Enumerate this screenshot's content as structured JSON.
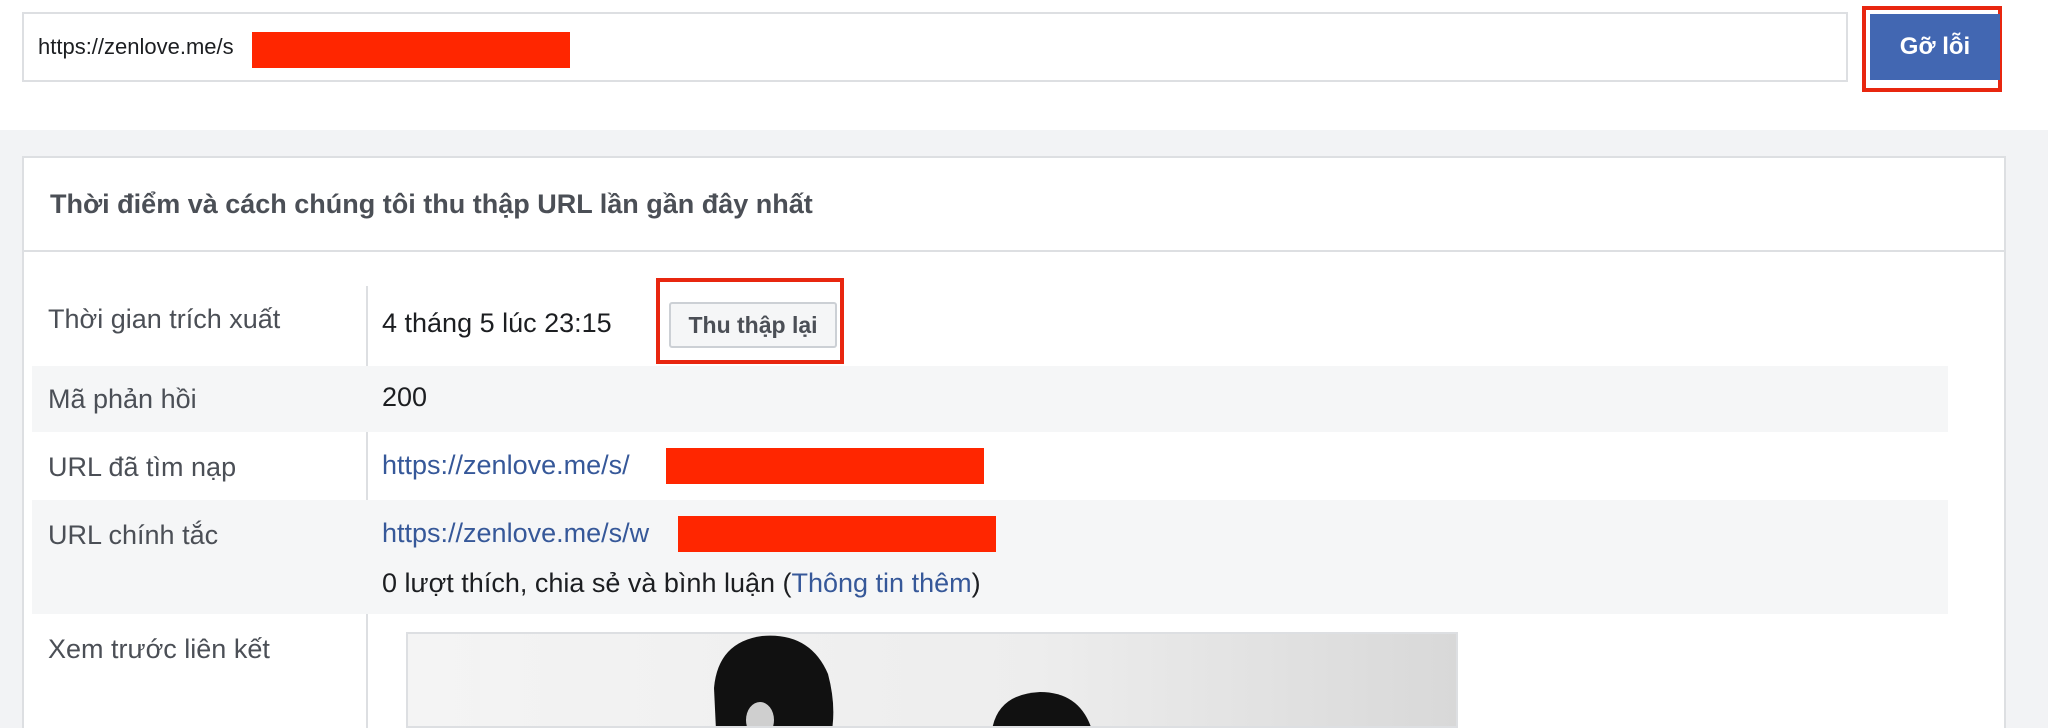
{
  "search": {
    "url_value": "https://zenlove.me/s",
    "debug_label": "Gỡ lỗi"
  },
  "card": {
    "title": "Thời điểm và cách chúng tôi thu thập URL lần gần đây nhất",
    "rows": {
      "scrape_time": {
        "label": "Thời gian trích xuất",
        "value": "4 tháng 5 lúc 23:15",
        "button": "Thu thập lại"
      },
      "response_code": {
        "label": "Mã phản hồi",
        "value": "200"
      },
      "fetched_url": {
        "label": "URL đã tìm nạp",
        "value": "https://zenlove.me/s/"
      },
      "canonical_url": {
        "label": "URL chính tắc",
        "value": "https://zenlove.me/s/w",
        "engagement_prefix": "0 lượt thích, chia sẻ và bình luận (",
        "engagement_link": "Thông tin thêm",
        "engagement_suffix": ")"
      },
      "link_preview": {
        "label": "Xem trước liên kết"
      }
    }
  },
  "colors": {
    "accent": "#4267b2",
    "link": "#365899",
    "redaction": "#ff2600",
    "highlight_frame": "#e8260f"
  }
}
